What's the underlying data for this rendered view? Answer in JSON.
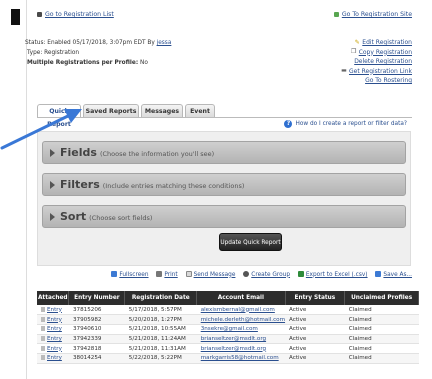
{
  "nav": {
    "back_link": "Go to Registration List",
    "site_link": "Go To Registration Site"
  },
  "info": {
    "status_label": "Status:",
    "status_value": "Enabled 05/17/2018, 3:07pm EDT By",
    "status_by": "jessa",
    "type_label": "Type:",
    "type_value": "Registration",
    "multiple_label": "Multiple Registrations per Profile:",
    "multiple_value": "No"
  },
  "actions": {
    "edit": "Edit Registration",
    "copy": "Copy Registration",
    "delete": "Delete Registration",
    "get_link": "Get Registration Link",
    "rostering": "Go To Rostering"
  },
  "tabs": [
    "Quick Report",
    "Saved Reports",
    "Messages",
    "Event"
  ],
  "help": {
    "text": "How do I create a report or filter data?"
  },
  "sections": [
    {
      "title": "Fields",
      "subtitle": "(Choose the information you'll see)"
    },
    {
      "title": "Filters",
      "subtitle": "(Include entries matching these conditions)"
    },
    {
      "title": "Sort",
      "subtitle": "(Choose sort fields)"
    }
  ],
  "update_button": "Update Quick Report",
  "toolbar": [
    "Fullscreen",
    "Print",
    "Send Message",
    "Create Group",
    "Export to Excel (.csv)",
    "Save As..."
  ],
  "table": {
    "headers": [
      "Attached",
      "Entry Number",
      "Registration Date",
      "Account Email",
      "Entry Status",
      "Unclaimed Profiles"
    ],
    "rows": [
      [
        "Entry",
        "37815206",
        "5/17/2018, 5:57PM",
        "alexismbernal@gmail.com",
        "Active",
        "Claimed"
      ],
      [
        "Entry",
        "37905982",
        "5/20/2018, 1:27PM",
        "michele.derleth@hotmail.com",
        "Active",
        "Claimed"
      ],
      [
        "Entry",
        "37940610",
        "5/21/2018, 10:55AM",
        "3nsekre@gmail.com",
        "Active",
        "Claimed"
      ],
      [
        "Entry",
        "37942339",
        "5/21/2018, 11:24AM",
        "brianseltzer@msdlt.org",
        "Active",
        "Claimed"
      ],
      [
        "Entry",
        "37942818",
        "5/21/2018, 11:31AM",
        "brianseltzer@msdlt.org",
        "Active",
        "Claimed"
      ],
      [
        "Entry",
        "38014254",
        "5/22/2018, 5:22PM",
        "markgarris58@hotmail.com",
        "Active",
        "Claimed"
      ]
    ]
  },
  "colors": {
    "link": "#2a4f8f",
    "pointer": "#3a78d6",
    "header_bg": "#2d2d2d"
  }
}
